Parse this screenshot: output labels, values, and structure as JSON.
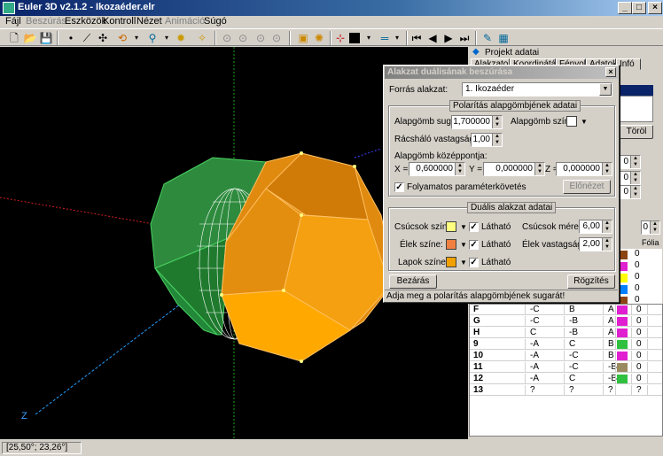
{
  "window": {
    "title": "Euler 3D v2.1.2 - Ikozaéder.elr"
  },
  "menu": [
    {
      "label": "Fájl",
      "enabled": true
    },
    {
      "label": "Beszúrás",
      "enabled": false
    },
    {
      "label": "Eszközök",
      "enabled": true
    },
    {
      "label": "Kontroll",
      "enabled": true
    },
    {
      "label": "Nézet",
      "enabled": true
    },
    {
      "label": "Animáció",
      "enabled": false
    },
    {
      "label": "Súgó",
      "enabled": true
    }
  ],
  "viewport": {
    "axis_label": "Z"
  },
  "status": {
    "coords": "[25,50°; 23,26°]"
  },
  "panel": {
    "header": "Projekt adatai",
    "tabs": [
      "Alakzatok",
      "Koordináták",
      "Fényok",
      "Adatok",
      "Infó"
    ],
    "button_delete": "Töröl",
    "spin_values": [
      "0",
      "0",
      "0"
    ],
    "grid_header_right": "Fólia",
    "grid_header_spin": "0",
    "rows": [
      {
        "name": "F",
        "a": "-C",
        "b": "B",
        "c": "A",
        "color": "#e020d0",
        "val": "0"
      },
      {
        "name": "G",
        "a": "-C",
        "b": "-B",
        "c": "A",
        "color": "#e020d0",
        "val": "0"
      },
      {
        "name": "H",
        "a": "C",
        "b": "-B",
        "c": "A",
        "color": "#e020d0",
        "val": "0"
      },
      {
        "name": "9",
        "a": "-A",
        "b": "C",
        "c": "B",
        "color": "#30c040",
        "val": "0"
      },
      {
        "name": "10",
        "a": "-A",
        "b": "-C",
        "c": "B",
        "color": "#e020d0",
        "val": "0"
      },
      {
        "name": "11",
        "a": "-A",
        "b": "-C",
        "c": "-B",
        "color": "#9a8a60",
        "val": "0"
      },
      {
        "name": "12",
        "a": "-A",
        "b": "C",
        "c": "-B",
        "color": "#30c040",
        "val": "0"
      },
      {
        "name": "13",
        "a": "?",
        "b": "?",
        "c": "?",
        "color": "",
        "val": "?"
      }
    ],
    "top_swatches": [
      "#8b4513",
      "#e020d0",
      "#ffff00",
      "#0080ff",
      "#8b4513"
    ],
    "top_vals": [
      "0",
      "0",
      "0",
      "0",
      "0"
    ]
  },
  "dialog": {
    "title": "Alakzat duálisának beszúrása",
    "source_label": "Forrás alakzat:",
    "source_value": "1. Ikozaéder",
    "polarity": {
      "title": "Polarítás alapgömbjének adatai",
      "radius_label": "Alapgömb sugara:",
      "radius_value": "1,700000",
      "color_label": "Alapgömb színe:",
      "mesh_label": "Rácsháló vastagsága:",
      "mesh_value": "1,00",
      "center_label": "Alapgömb középpontja:",
      "x_label": "X =",
      "x_value": "0,600000",
      "y_label": "Y =",
      "y_value": "0,000000",
      "z_label": "Z =",
      "z_value": "0,000000",
      "follow_label": "Folyamatos paraméterkövetés",
      "preview_label": "Előnézet"
    },
    "dual": {
      "title": "Duális alakzat adatai",
      "vertex_color_label": "Csúcsok színe:",
      "edge_color_label": "Élek színe:",
      "face_color_label": "Lapok színe:",
      "visible_label": "Látható",
      "vertex_size_label": "Csúcsok mérete:",
      "vertex_size_value": "6,00",
      "edge_width_label": "Élek vastagsága:",
      "edge_width_value": "2,00",
      "vertex_color": "#ffff80",
      "edge_color": "#f08040",
      "face_color": "#f0a000"
    },
    "close_label": "Bezárás",
    "save_label": "Rögzítés",
    "status": "Adja meg a polarítás alapgömbjének sugarát!"
  }
}
